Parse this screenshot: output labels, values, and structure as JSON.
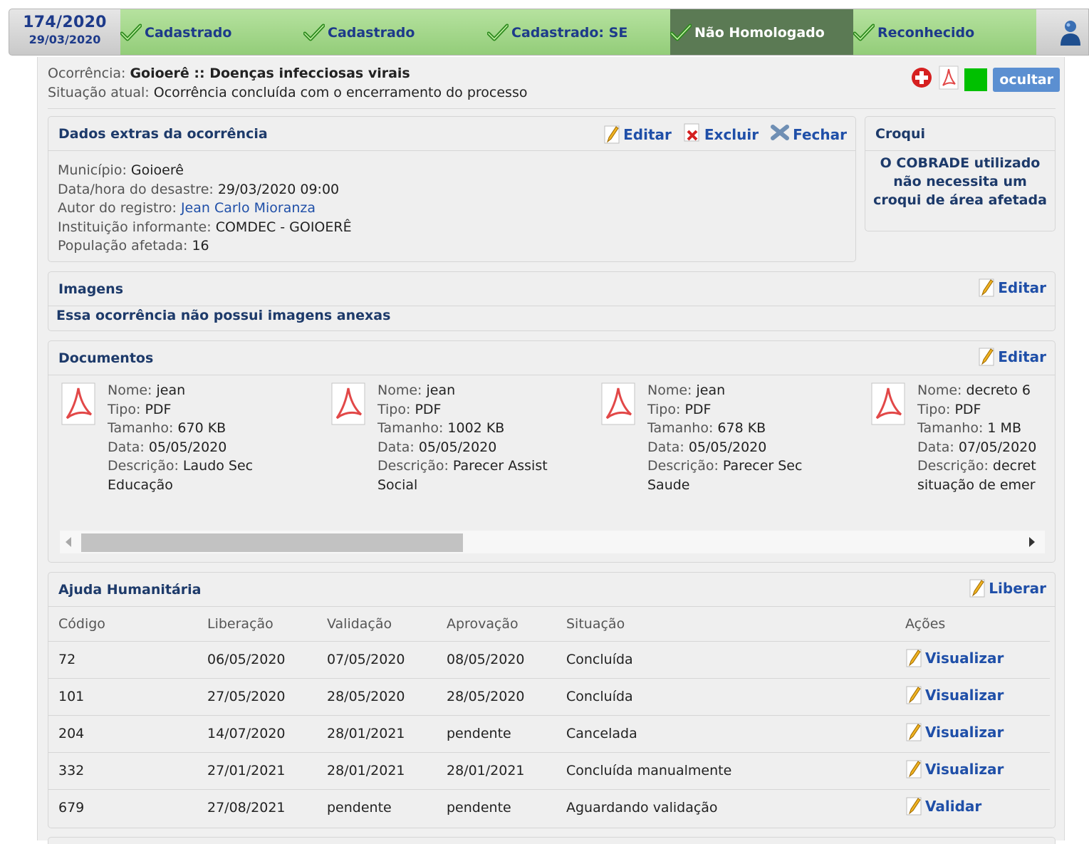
{
  "header": {
    "case_number": "174/2020",
    "case_date": "29/03/2020",
    "steps": [
      {
        "label": "Cadastrado"
      },
      {
        "label": "Cadastrado"
      },
      {
        "label": "Cadastrado: SE"
      },
      {
        "label": "Não Homologado"
      },
      {
        "label": "Reconhecido"
      }
    ]
  },
  "occurrence": {
    "title_label": "Ocorrência:",
    "title_value": "Goioerê :: Doenças infecciosas virais",
    "status_label": "Situação atual:",
    "status_value": "Ocorrência concluída com o encerramento do processo",
    "hide_label": "ocultar",
    "status_color": "#00c000"
  },
  "extra_data": {
    "title": "Dados extras da ocorrência",
    "edit_label": "Editar",
    "delete_label": "Excluir",
    "close_label": "Fechar",
    "fields": [
      {
        "key": "Município:",
        "value": "Goioerê"
      },
      {
        "key": "Data/hora do desastre:",
        "value": "29/03/2020 09:00"
      },
      {
        "key": "Autor do registro:",
        "value": "Jean Carlo Mioranza"
      },
      {
        "key": "Instituição informante:",
        "value": "COMDEC - GOIOERÊ"
      },
      {
        "key": "População afetada:",
        "value": "16"
      }
    ]
  },
  "croqui": {
    "title": "Croqui",
    "message": "O COBRADE utilizado não necessita um croqui de área afetada"
  },
  "images": {
    "title": "Imagens",
    "edit_label": "Editar",
    "empty_message": "Essa ocorrência não possui imagens anexas"
  },
  "documents": {
    "title": "Documentos",
    "edit_label": "Editar",
    "labels": {
      "name": "Nome:",
      "type": "Tipo:",
      "size": "Tamanho:",
      "date": "Data:",
      "description": "Descrição:"
    },
    "items": [
      {
        "name": "jean",
        "type": "PDF",
        "size": "670 KB",
        "date": "05/05/2020",
        "desc1": "Laudo Sec",
        "desc2": "Educação"
      },
      {
        "name": "jean",
        "type": "PDF",
        "size": "1002 KB",
        "date": "05/05/2020",
        "desc1": "Parecer Assist",
        "desc2": "Social"
      },
      {
        "name": "jean",
        "type": "PDF",
        "size": "678 KB",
        "date": "05/05/2020",
        "desc1": "Parecer Sec",
        "desc2": "Saude"
      },
      {
        "name": "decreto 6",
        "type": "PDF",
        "size": "1 MB",
        "date": "07/05/2020",
        "desc1": "decret",
        "desc2": "situação de emer"
      }
    ],
    "scroll_fraction": 0.39
  },
  "aid": {
    "title": "Ajuda Humanitária",
    "release_label": "Liberar",
    "columns": [
      "Código",
      "Liberação",
      "Validação",
      "Aprovação",
      "Situação",
      "Ações"
    ],
    "rows": [
      {
        "code": "72",
        "release": "06/05/2020",
        "validation": "07/05/2020",
        "approval": "08/05/2020",
        "status": "Concluída",
        "action": "Visualizar"
      },
      {
        "code": "101",
        "release": "27/05/2020",
        "validation": "28/05/2020",
        "approval": "28/05/2020",
        "status": "Concluída",
        "action": "Visualizar"
      },
      {
        "code": "204",
        "release": "14/07/2020",
        "validation": "28/01/2021",
        "approval": "pendente",
        "status": "Cancelada",
        "action": "Visualizar"
      },
      {
        "code": "332",
        "release": "27/01/2021",
        "validation": "28/01/2021",
        "approval": "28/01/2021",
        "status": "Concluída manualmente",
        "action": "Visualizar"
      },
      {
        "code": "679",
        "release": "27/08/2021",
        "validation": "pendente",
        "approval": "pendente",
        "status": "Aguardando validação",
        "action": "Validar"
      }
    ]
  }
}
